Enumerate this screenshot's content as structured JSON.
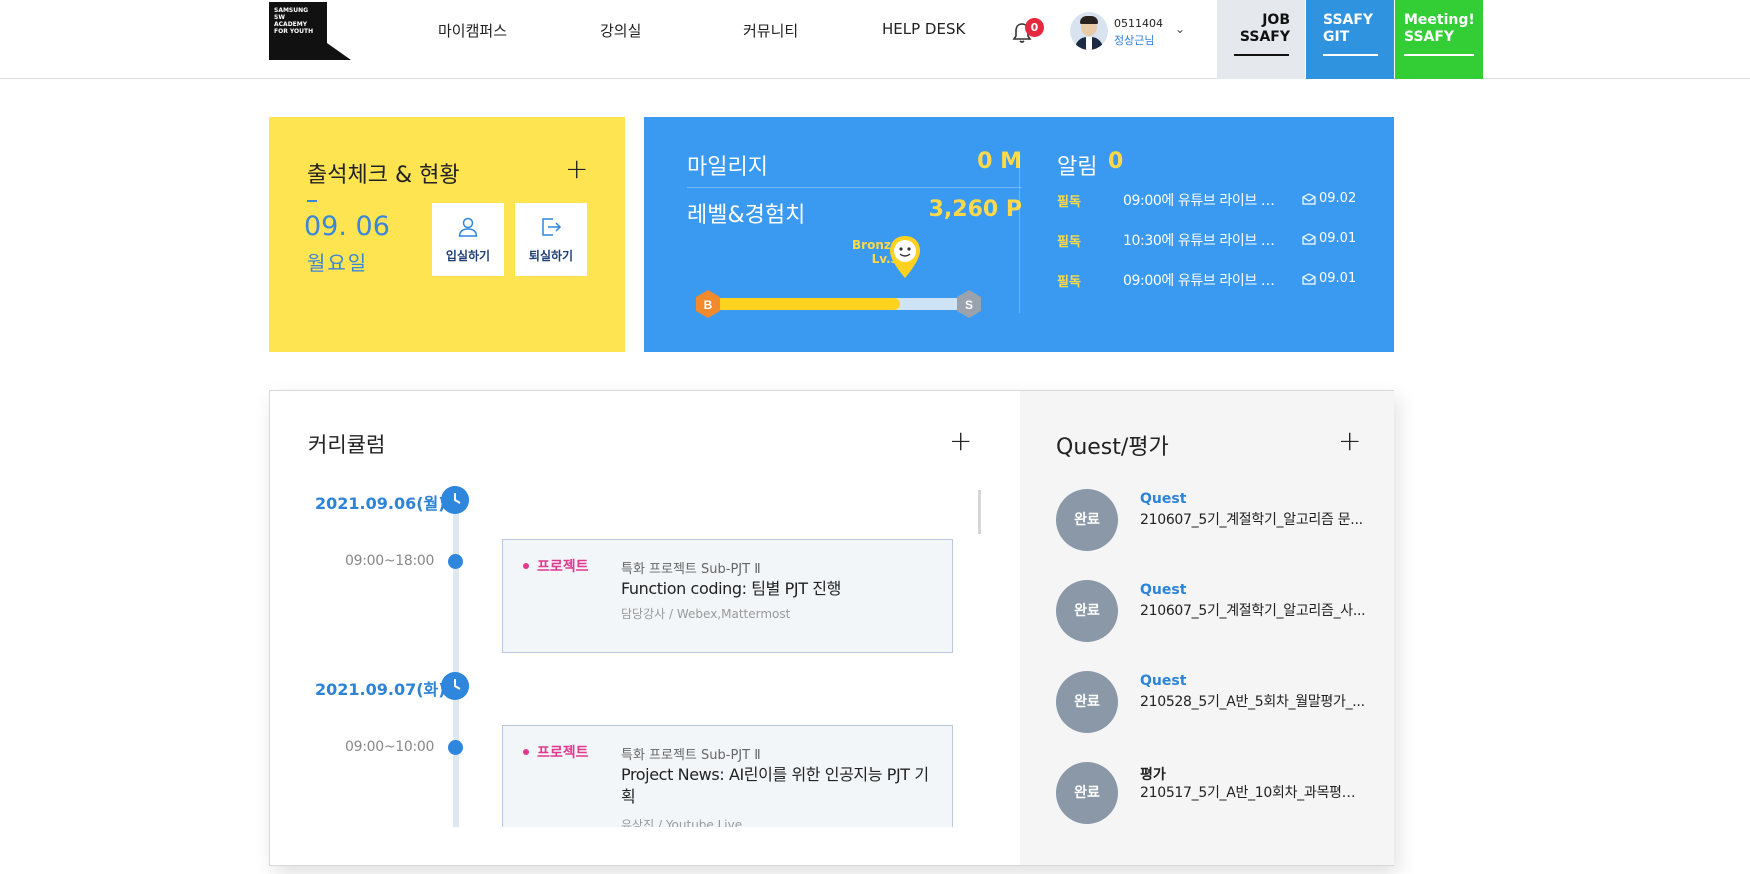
{
  "logo": {
    "text": "SAMSUNG SW ACADEMY FOR YOUTH"
  },
  "nav": [
    {
      "label": "마이캠퍼스"
    },
    {
      "label": "강의실"
    },
    {
      "label": "커뮤니티"
    },
    {
      "label": "HELP DESK"
    }
  ],
  "notifications": {
    "count": "0"
  },
  "user": {
    "id": "0511404",
    "name": "정상근님"
  },
  "quick_links": {
    "job": {
      "line1": "JOB",
      "line2": "SSAFY"
    },
    "git": {
      "line1": "SSAFY",
      "line2": "GIT"
    },
    "meeting": {
      "line1": "Meeting!",
      "line2": "SSAFY"
    }
  },
  "attendance": {
    "title": "출석체크 & 현황",
    "date": "09. 06",
    "day": "월요일",
    "check_in_label": "입실하기",
    "check_out_label": "퇴실하기"
  },
  "mileage": {
    "mileage_label": "마일리지",
    "mileage_value": "0 M",
    "level_label": "레벨&경험치",
    "level_value": "3,260 P",
    "tier_name": "Bronze",
    "tier_level": "Lv.3",
    "start_badge": "B",
    "end_badge": "S",
    "progress_fraction": 0.73
  },
  "alerts": {
    "title": "알림",
    "count": "0",
    "items": [
      {
        "tag": "필독",
        "title": "09:00에 유튜브 라이브 방...",
        "date": "09.02"
      },
      {
        "tag": "필독",
        "title": "10:30에 유튜브 라이브 방...",
        "date": "09.01"
      },
      {
        "tag": "필독",
        "title": "09:00에 유튜브 라이브 방...",
        "date": "09.01"
      }
    ]
  },
  "curriculum": {
    "title": "커리큘럼",
    "days": [
      {
        "date": "2021.09.06(월)",
        "time": "09:00~18:00",
        "tag": "프로젝트",
        "sub": "특화 프로젝트 Sub-PJT Ⅱ",
        "main": "Function coding: 팀별 PJT 진행",
        "instructor": "담당강사",
        "platform": "Webex,Mattermost"
      },
      {
        "date": "2021.09.07(화)",
        "time": "09:00~10:00",
        "tag": "프로젝트",
        "sub": "특화 프로젝트 Sub-PJT Ⅱ",
        "main": "Project News: AI린이를 위한 인공지능 PJT 기획",
        "instructor": "유상진",
        "platform": "Youtube Live"
      }
    ]
  },
  "quest": {
    "title": "Quest/평가",
    "items": [
      {
        "status": "완료",
        "kind": "Quest",
        "name": "210607_5기_계절학기_알고리즘 문..."
      },
      {
        "status": "완료",
        "kind": "Quest",
        "name": "210607_5기_계절학기_알고리즘_사..."
      },
      {
        "status": "완료",
        "kind": "Quest",
        "name": "210528_5기_A반_5회차_월말평가_..."
      },
      {
        "status": "완료",
        "kind": "평가",
        "name": "210517_5기_A반_10회차_과목평가..."
      }
    ]
  },
  "colors": {
    "attendance_bg": "#ffe451",
    "mileage_bg": "#3a99f0",
    "accent_yellow": "#ffd94a",
    "accent_blue": "#2c83d8",
    "tag_pink": "#e0398f",
    "job_bg": "#e5e9ed",
    "git_bg": "#2f93e0",
    "meeting_bg": "#33cd36"
  }
}
